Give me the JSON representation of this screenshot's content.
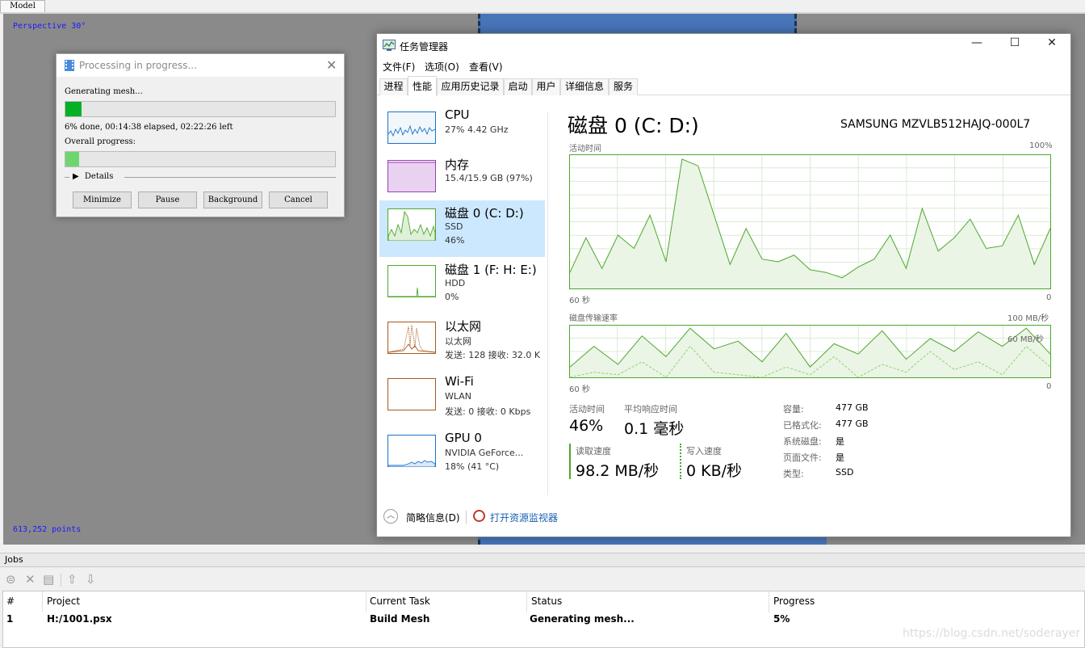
{
  "model_tab": "Model",
  "viewport": {
    "view_label": "Perspective 30°",
    "points_label": "613,252 points"
  },
  "processing": {
    "title": "Processing in progress...",
    "status": "Generating mesh...",
    "progress_fraction": 0.06,
    "time_text": "6% done, 00:14:38 elapsed, 02:22:26 left",
    "overall_label": "Overall progress:",
    "overall_fraction": 0.05,
    "details_label": "Details",
    "buttons": {
      "minimize": "Minimize",
      "pause": "Pause",
      "background": "Background",
      "cancel": "Cancel"
    }
  },
  "taskmgr": {
    "title": "任务管理器",
    "menu": [
      "文件(F)",
      "选项(O)",
      "查看(V)"
    ],
    "tabs": [
      "进程",
      "性能",
      "应用历史记录",
      "启动",
      "用户",
      "详细信息",
      "服务"
    ],
    "sidebar": [
      {
        "name": "CPU",
        "sub1": "27%  4.42 GHz",
        "sub2": "",
        "color": "#1a73c6"
      },
      {
        "name": "内存",
        "sub1": "15.4/15.9 GB (97%)",
        "sub2": "",
        "color": "#9b3fb0"
      },
      {
        "name": "磁盘 0 (C: D:)",
        "sub1": "SSD",
        "sub2": "46%",
        "color": "#4ea72e"
      },
      {
        "name": "磁盘 1 (F: H: E:)",
        "sub1": "HDD",
        "sub2": "0%",
        "color": "#4ea72e"
      },
      {
        "name": "以太网",
        "sub1": "以太网",
        "sub2": "发送: 128  接收: 32.0 K",
        "color": "#a7581e"
      },
      {
        "name": "Wi-Fi",
        "sub1": "WLAN",
        "sub2": "发送: 0  接收: 0 Kbps",
        "color": "#a7581e"
      },
      {
        "name": "GPU 0",
        "sub1": "NVIDIA GeForce...",
        "sub2": "18%  (41 °C)",
        "color": "#1a73c6"
      }
    ],
    "detail": {
      "title": "磁盘 0 (C: D:)",
      "model": "SAMSUNG MZVLB512HAJQ-000L7",
      "chart1_label": "活动时间",
      "chart1_max": "100%",
      "chart1_left": "60 秒",
      "chart1_right": "0",
      "chart2_label": "磁盘传输速率",
      "chart2_max": "100 MB/秒",
      "chart2_mid": "60 MB/秒",
      "chart2_left": "60 秒",
      "chart2_right": "0",
      "active_label": "活动时间",
      "active_value": "46%",
      "resp_label": "平均响应时间",
      "resp_value": "0.1 毫秒",
      "read_label": "读取速度",
      "read_value": "98.2 MB/秒",
      "write_label": "写入速度",
      "write_value": "0 KB/秒",
      "props": [
        {
          "label": "容量:",
          "value": "477 GB"
        },
        {
          "label": "已格式化:",
          "value": "477 GB"
        },
        {
          "label": "系统磁盘:",
          "value": "是"
        },
        {
          "label": "页面文件:",
          "value": "是"
        },
        {
          "label": "类型:",
          "value": "SSD"
        }
      ]
    },
    "footer": {
      "brief": "简略信息(D)",
      "resmon": "打开资源监视器"
    }
  },
  "chart_data": [
    {
      "type": "area",
      "title": "活动时间",
      "x": [
        60,
        58,
        56,
        54,
        52,
        50,
        48,
        46,
        44,
        42,
        40,
        38,
        36,
        34,
        32,
        30,
        28,
        26,
        24,
        22,
        20,
        18,
        16,
        14,
        12,
        10,
        8,
        6,
        4,
        2,
        0
      ],
      "values": [
        12,
        38,
        15,
        40,
        30,
        55,
        20,
        97,
        92,
        55,
        18,
        45,
        22,
        20,
        25,
        14,
        12,
        8,
        16,
        22,
        40,
        15,
        60,
        28,
        38,
        52,
        30,
        32,
        55,
        18,
        45
      ],
      "ylim": [
        0,
        100
      ]
    },
    {
      "type": "line",
      "title": "磁盘传输速率",
      "x": [
        60,
        57,
        54,
        51,
        48,
        45,
        42,
        39,
        36,
        33,
        30,
        27,
        24,
        21,
        18,
        15,
        12,
        9,
        6,
        3,
        0
      ],
      "series": [
        {
          "values": [
            20,
            60,
            25,
            80,
            40,
            95,
            55,
            70,
            30,
            85,
            20,
            65,
            45,
            90,
            35,
            75,
            50,
            88,
            60,
            95,
            45
          ]
        },
        {
          "values": [
            0,
            10,
            5,
            30,
            0,
            60,
            10,
            5,
            0,
            20,
            5,
            40,
            0,
            25,
            10,
            50,
            15,
            30,
            5,
            60,
            20
          ]
        }
      ],
      "ylim": [
        0,
        100
      ]
    }
  ],
  "jobs": {
    "label": "Jobs",
    "columns": [
      "#",
      "Project",
      "Current Task",
      "Status",
      "Progress"
    ],
    "rows": [
      {
        "num": "1",
        "project": "H:/1001.psx",
        "task": "Build Mesh",
        "status": "Generating mesh...",
        "progress": "5%"
      }
    ]
  },
  "watermark": "https://blog.csdn.net/soderayer"
}
